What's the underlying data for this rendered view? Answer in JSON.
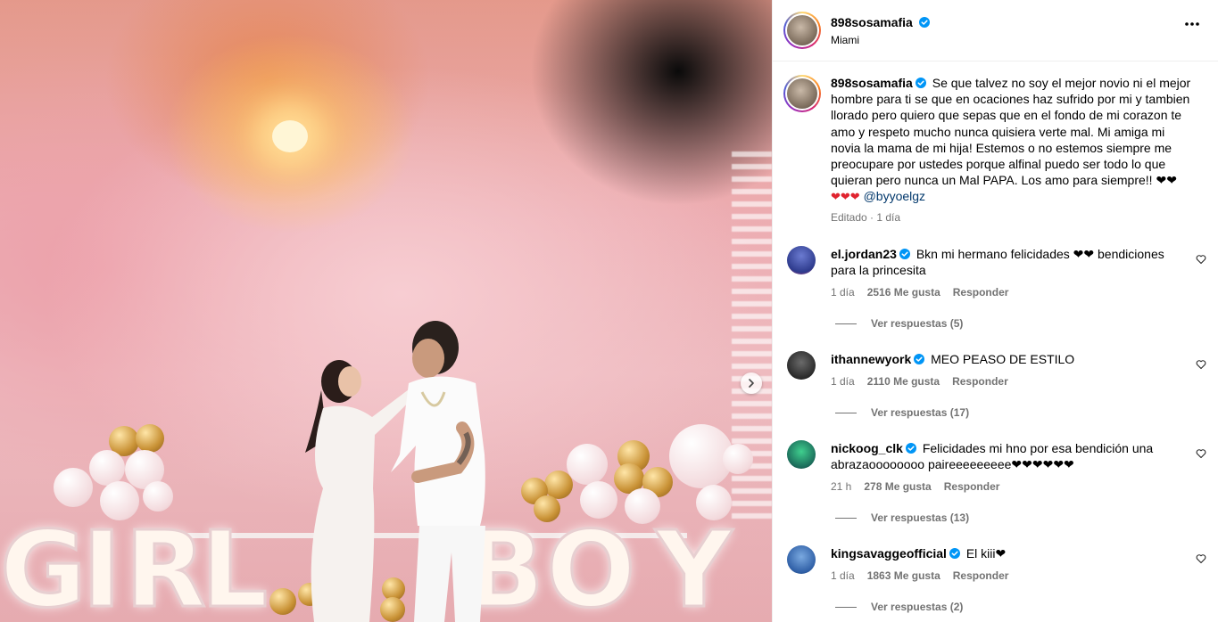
{
  "post": {
    "username": "898sosamafia",
    "location": "Miami",
    "caption": "Se que talvez no soy el mejor novio ni el mejor hombre para ti se que en ocaciones haz sufrido por mi y tambien llorado pero quiero que sepas que en el fondo de mi corazon te amo y respeto mucho nunca quisiera verte mal. Mi amiga mi novia la mama de mi hija! Estemos o no estemos siempre me preocupare por ustedes porque alfinal puedo ser todo lo que quieran pero nunca un Mal PAPA. Los amo para siempre!! ❤❤",
    "caption_tail": "❤❤❤",
    "mention": "@byyoelgz",
    "edited": "Editado",
    "time": "1 día",
    "photo_letters": [
      "G",
      "I",
      "R",
      "L",
      "B",
      "O",
      "Y"
    ]
  },
  "comments": [
    {
      "username": "el.jordan23",
      "text": "Bkn mi hermano felicidades ❤❤ bendiciones para la princesita",
      "time": "1 día",
      "likes": "2516 Me gusta",
      "reply": "Responder",
      "replies": "Ver respuestas (5)"
    },
    {
      "username": "ithannewyork",
      "text": "MEO PEASO DE ESTILO",
      "time": "1 día",
      "likes": "2110 Me gusta",
      "reply": "Responder",
      "replies": "Ver respuestas (17)"
    },
    {
      "username": "nickoog_clk",
      "text": "Felicidades mi hno por esa bendición una abrazaoooooooo paireeeeeeeee❤❤❤❤❤❤",
      "time": "21 h",
      "likes": "278 Me gusta",
      "reply": "Responder",
      "replies": "Ver respuestas (13)"
    },
    {
      "username": "kingsavaggeofficial",
      "text": "El kiii❤",
      "time": "1 día",
      "likes": "1863 Me gusta",
      "reply": "Responder",
      "replies": "Ver respuestas (2)"
    }
  ],
  "colors": {
    "verified": "#0095f6",
    "meta": "#737373",
    "mention": "#00376b",
    "heart": "#e0242f"
  },
  "icons": [
    "more-options-icon",
    "verified-badge-icon",
    "heart-outline-icon",
    "chevron-right-icon"
  ]
}
